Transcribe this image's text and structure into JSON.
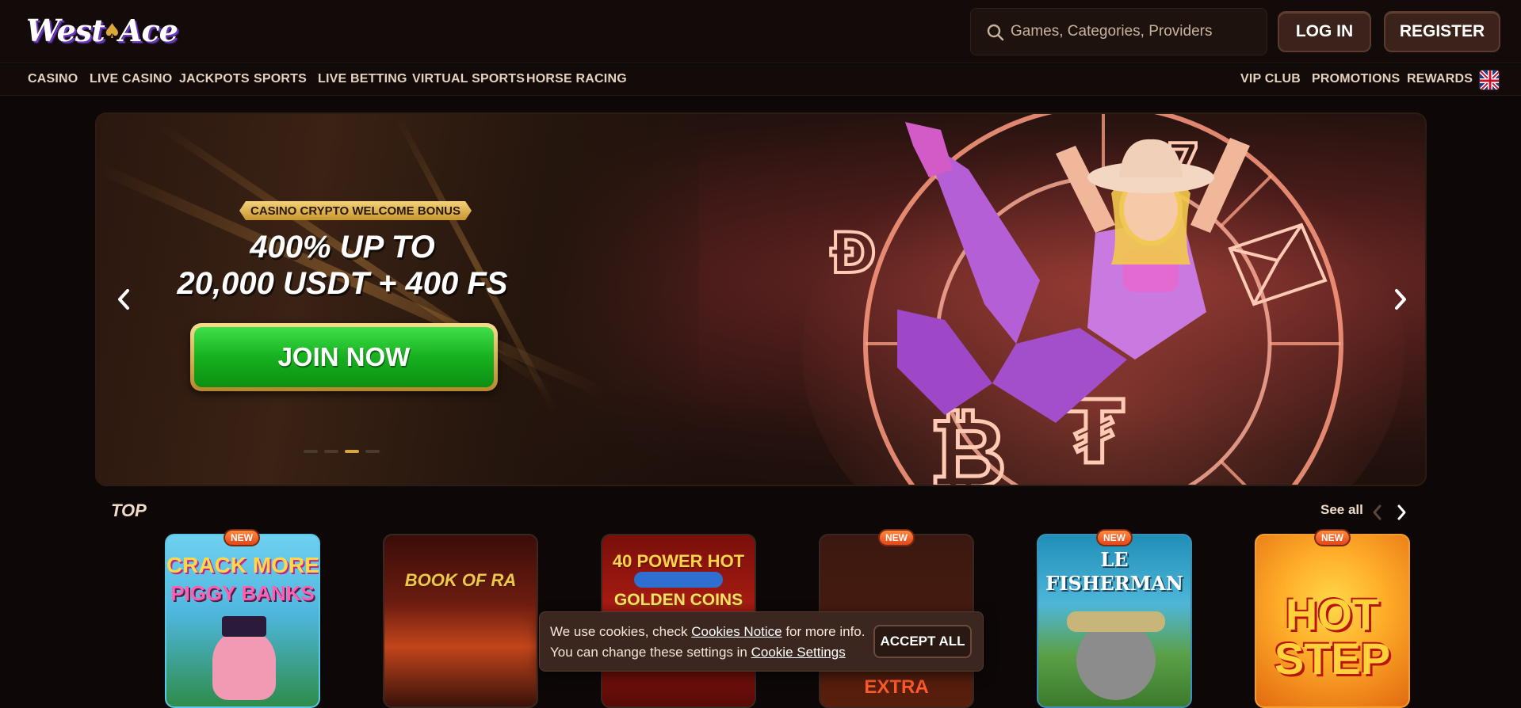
{
  "header": {
    "logo_text": "West Ace",
    "search_placeholder": "Games, Categories, Providers",
    "login_label": "LOG IN",
    "register_label": "REGISTER"
  },
  "nav": {
    "left": [
      "CASINO",
      "LIVE CASINO",
      "JACKPOTS",
      "SPORTS",
      "LIVE BETTING",
      "VIRTUAL SPORTS",
      "HORSE RACING"
    ],
    "right": [
      "VIP CLUB",
      "PROMOTIONS",
      "REWARDS"
    ],
    "language_icon": "uk-flag-icon"
  },
  "banner": {
    "badge": "CASINO CRYPTO WELCOME BONUS",
    "line1": "400% UP TO",
    "line2": "20,000 USDT + 400 FS",
    "cta": "JOIN NOW",
    "slide_count": 4,
    "active_slide": 3
  },
  "top_section": {
    "title": "TOP",
    "see_all": "See all",
    "games": [
      {
        "title_line1": "CRACK MORE",
        "title_line2": "PIGGY BANKS",
        "new": true,
        "new_label": "NEW"
      },
      {
        "title_line1": "BOOK OF RA",
        "title_line2": "",
        "new": false,
        "new_label": ""
      },
      {
        "title_line1": "40 POWER HOT",
        "title_line2": "GOLDEN COINS",
        "new": false,
        "new_label": ""
      },
      {
        "title_line1": "",
        "title_line2": "EXTRA",
        "new": true,
        "new_label": "NEW"
      },
      {
        "title_line1": "LE",
        "title_line2": "FISHERMAN",
        "new": true,
        "new_label": "NEW"
      },
      {
        "title_line1": "HOT",
        "title_line2": "STEP",
        "new": true,
        "new_label": "NEW"
      }
    ]
  },
  "cookie": {
    "text_before": "We use cookies, check ",
    "link1": "Cookies Notice",
    "text_middle": " for more info. You can change these settings in ",
    "link2": "Cookie Settings",
    "accept_label": "ACCEPT ALL"
  },
  "colors": {
    "background": "#0d0807",
    "accent_gold": "#d6a640",
    "cta_green": "#17b01f",
    "new_badge": "#e3461c"
  }
}
